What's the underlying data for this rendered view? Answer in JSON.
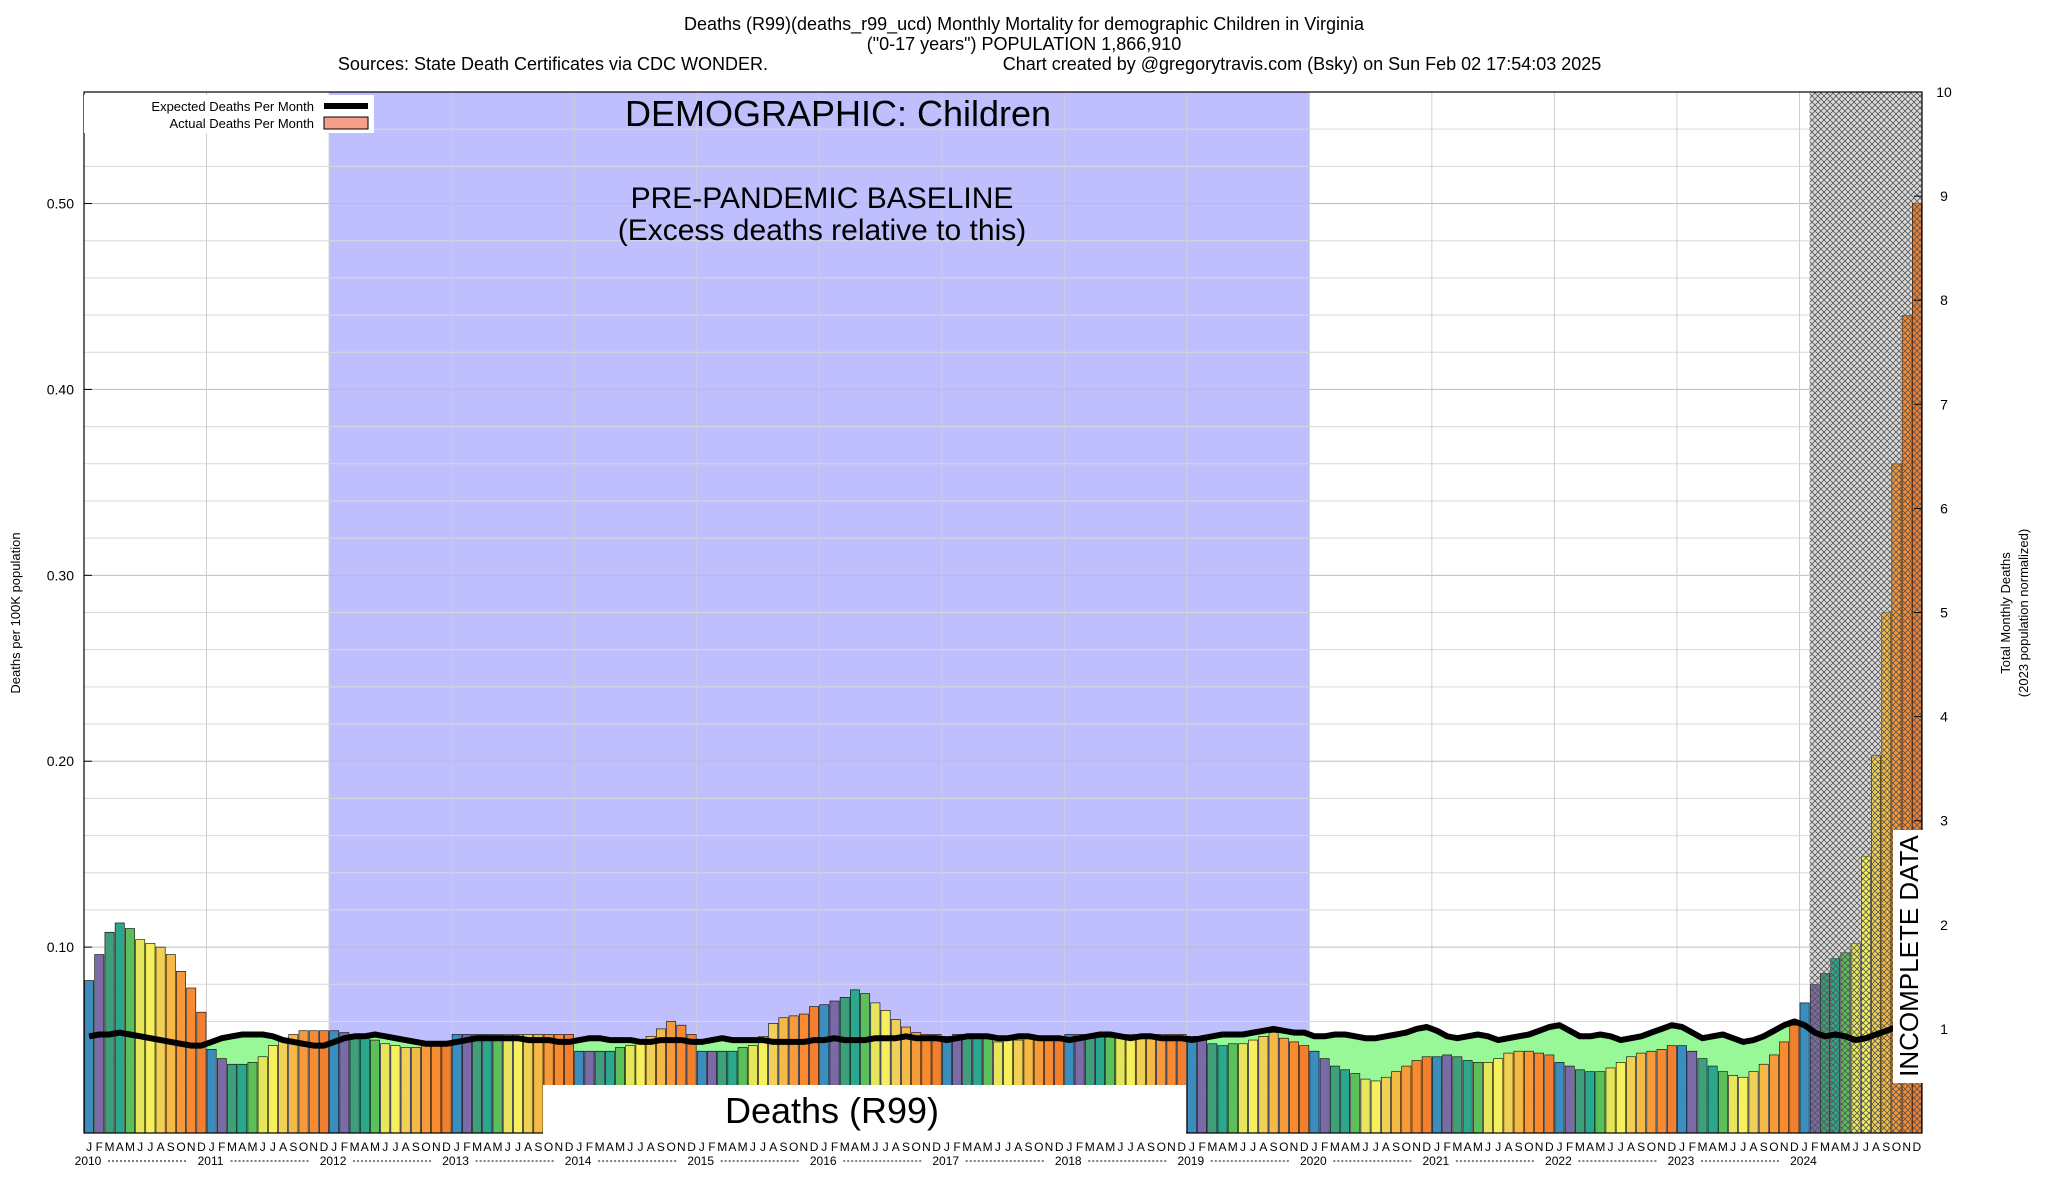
{
  "header": {
    "line1": "Deaths (R99)(deaths_r99_ucd) Monthly Mortality for demographic Children in Virginia",
    "line2": "(\"0-17 years\") POPULATION 1,866,910",
    "line3_left": "Sources: State Death Certificates via CDC WONDER.",
    "line3_right": "Chart created by @gregorytravis.com (Bsky) on Sun Feb 02 17:54:03 2025"
  },
  "annotations": {
    "demographic": "DEMOGRAPHIC: Children",
    "baseline_line1": "PRE-PANDEMIC BASELINE",
    "baseline_line2": "(Excess deaths relative to this)",
    "cause_label": "Deaths (R99)",
    "incomplete": "INCOMPLETE DATA"
  },
  "legend": {
    "expected": "Expected Deaths Per Month",
    "actual": "Actual Deaths Per Month"
  },
  "axes": {
    "ylabel_left": "Deaths per 100K population",
    "ylabel_right_1": "Total Monthly Deaths",
    "ylabel_right_2": "(2023 population normalized)",
    "left_ticks": [
      "0.10",
      "0.20",
      "0.30",
      "0.40",
      "0.50"
    ],
    "right_ticks": [
      "1",
      "2",
      "3",
      "4",
      "5",
      "6",
      "7",
      "8",
      "9",
      "10"
    ],
    "month_letters": [
      "J",
      "F",
      "M",
      "A",
      "M",
      "J",
      "J",
      "A",
      "S",
      "O",
      "N",
      "D"
    ],
    "years": [
      "2010",
      "2011",
      "2012",
      "2013",
      "2014",
      "2015",
      "2016",
      "2017",
      "2018",
      "2019",
      "2020",
      "2021",
      "2022",
      "2023",
      "2024"
    ]
  },
  "colors": {
    "baseline_shade": "#bfbffd",
    "deficit_fill": "#98f898",
    "expected_line": "#000000",
    "legend_actual": "#f5a08a",
    "month_palette": [
      "#3a8dbc",
      "#7a6aa6",
      "#3e9f7a",
      "#2ba88c",
      "#5bbf5a",
      "#e6e65a",
      "#f6f05c",
      "#f0d055",
      "#f5b946",
      "#f69a3a",
      "#f88a30",
      "#f08030"
    ]
  },
  "chart_data": {
    "type": "bar",
    "x_start": "2010-01",
    "x_end": "2024-12",
    "ylim_left": [
      0.0,
      0.56
    ],
    "ylim_right": [
      0.0,
      10.0
    ],
    "baseline_period": [
      "2012-01",
      "2019-12"
    ],
    "incomplete_period": [
      "2024-02",
      "2024-12"
    ],
    "series": [
      {
        "name": "Actual Deaths Per Month",
        "values": [
          0.082,
          0.096,
          0.108,
          0.113,
          0.11,
          0.104,
          0.102,
          0.1,
          0.096,
          0.087,
          0.078,
          0.065,
          0.045,
          0.04,
          0.037,
          0.037,
          0.038,
          0.041,
          0.047,
          0.051,
          0.053,
          0.055,
          0.055,
          0.055,
          0.055,
          0.054,
          0.053,
          0.052,
          0.05,
          0.048,
          0.047,
          0.046,
          0.046,
          0.047,
          0.048,
          0.049,
          0.053,
          0.053,
          0.053,
          0.053,
          0.053,
          0.053,
          0.053,
          0.053,
          0.053,
          0.053,
          0.053,
          0.053,
          0.044,
          0.044,
          0.044,
          0.044,
          0.046,
          0.047,
          0.048,
          0.052,
          0.056,
          0.06,
          0.058,
          0.053,
          0.044,
          0.044,
          0.044,
          0.044,
          0.046,
          0.047,
          0.052,
          0.059,
          0.062,
          0.063,
          0.064,
          0.068,
          0.069,
          0.071,
          0.073,
          0.077,
          0.075,
          0.07,
          0.066,
          0.061,
          0.057,
          0.054,
          0.053,
          0.053,
          0.052,
          0.053,
          0.053,
          0.053,
          0.051,
          0.049,
          0.05,
          0.05,
          0.051,
          0.052,
          0.052,
          0.051,
          0.053,
          0.053,
          0.053,
          0.053,
          0.053,
          0.053,
          0.053,
          0.053,
          0.053,
          0.053,
          0.053,
          0.053,
          0.052,
          0.05,
          0.048,
          0.047,
          0.048,
          0.048,
          0.05,
          0.052,
          0.054,
          0.051,
          0.049,
          0.047,
          0.044,
          0.04,
          0.036,
          0.034,
          0.032,
          0.029,
          0.028,
          0.03,
          0.033,
          0.036,
          0.039,
          0.041,
          0.041,
          0.042,
          0.041,
          0.039,
          0.038,
          0.038,
          0.04,
          0.043,
          0.044,
          0.044,
          0.043,
          0.042,
          0.038,
          0.036,
          0.034,
          0.033,
          0.033,
          0.035,
          0.038,
          0.041,
          0.043,
          0.044,
          0.045,
          0.047,
          0.047,
          0.044,
          0.04,
          0.036,
          0.033,
          0.031,
          0.03,
          0.033,
          0.037,
          0.042,
          0.049,
          0.058,
          0.07,
          0.08,
          0.086,
          0.094,
          0.097,
          0.102,
          0.149,
          0.203,
          0.28,
          0.36,
          0.44,
          0.5
        ]
      },
      {
        "name": "Expected Deaths Per Month",
        "values": [
          0.052,
          0.053,
          0.053,
          0.054,
          0.053,
          0.052,
          0.051,
          0.05,
          0.049,
          0.048,
          0.047,
          0.047,
          0.049,
          0.051,
          0.052,
          0.053,
          0.053,
          0.053,
          0.052,
          0.05,
          0.049,
          0.048,
          0.047,
          0.047,
          0.049,
          0.051,
          0.052,
          0.052,
          0.053,
          0.052,
          0.051,
          0.05,
          0.049,
          0.048,
          0.048,
          0.048,
          0.049,
          0.05,
          0.051,
          0.051,
          0.051,
          0.051,
          0.051,
          0.05,
          0.05,
          0.05,
          0.049,
          0.049,
          0.05,
          0.051,
          0.051,
          0.05,
          0.05,
          0.05,
          0.049,
          0.049,
          0.05,
          0.05,
          0.05,
          0.049,
          0.049,
          0.05,
          0.051,
          0.05,
          0.05,
          0.05,
          0.05,
          0.049,
          0.049,
          0.049,
          0.049,
          0.05,
          0.05,
          0.051,
          0.05,
          0.05,
          0.05,
          0.051,
          0.051,
          0.051,
          0.052,
          0.051,
          0.051,
          0.051,
          0.05,
          0.051,
          0.052,
          0.052,
          0.052,
          0.051,
          0.051,
          0.052,
          0.052,
          0.051,
          0.051,
          0.051,
          0.05,
          0.051,
          0.052,
          0.053,
          0.053,
          0.052,
          0.051,
          0.052,
          0.052,
          0.051,
          0.051,
          0.051,
          0.05,
          0.051,
          0.052,
          0.053,
          0.053,
          0.053,
          0.054,
          0.055,
          0.056,
          0.055,
          0.054,
          0.054,
          0.052,
          0.052,
          0.053,
          0.053,
          0.052,
          0.051,
          0.051,
          0.052,
          0.053,
          0.054,
          0.056,
          0.057,
          0.055,
          0.052,
          0.051,
          0.052,
          0.053,
          0.052,
          0.05,
          0.051,
          0.052,
          0.053,
          0.055,
          0.057,
          0.058,
          0.055,
          0.052,
          0.052,
          0.053,
          0.052,
          0.05,
          0.051,
          0.052,
          0.054,
          0.056,
          0.058,
          0.057,
          0.054,
          0.051,
          0.052,
          0.053,
          0.051,
          0.049,
          0.05,
          0.052,
          0.055,
          0.058,
          0.06,
          0.058,
          0.054,
          0.052,
          0.053,
          0.052,
          0.05,
          0.051,
          0.053,
          0.055,
          0.057,
          0.059,
          0.061
        ]
      }
    ],
    "title": "Deaths (R99)(deaths_r99_ucd) Monthly Mortality for demographic Children in Virginia",
    "ylabel": "Deaths per 100K population",
    "ylabel_right": "Total Monthly Deaths",
    "grid": true,
    "legend_position": "top-left"
  }
}
